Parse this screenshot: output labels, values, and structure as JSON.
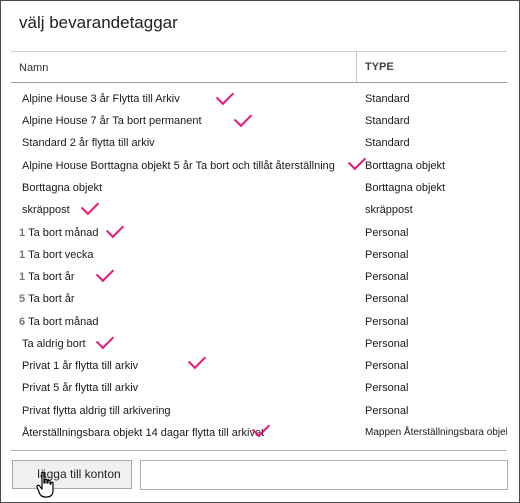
{
  "dialog": {
    "title": "välj bevarandetaggar"
  },
  "table": {
    "headers": {
      "name": "Namn",
      "type": "TYPE"
    },
    "rows": [
      {
        "prefix": "",
        "name": "Alpine House 3 år Flytta till Arkiv",
        "type": "Standard",
        "checked": true
      },
      {
        "prefix": "",
        "name": "Alpine House 7 år Ta bort permanent",
        "type": "Standard",
        "checked": true
      },
      {
        "prefix": "",
        "name": "Standard 2 år flytta till arkiv",
        "type": "Standard",
        "checked": false
      },
      {
        "prefix": "",
        "name": "Alpine House Borttagna objekt 5 år Ta bort och tillåt återställning",
        "type": "Borttagna objekt",
        "checked": true
      },
      {
        "prefix": "",
        "name": "Borttagna objekt",
        "type": "Borttagna objekt",
        "checked": false
      },
      {
        "prefix": "",
        "name": "skräppost",
        "type": "skräppost",
        "checked": true
      },
      {
        "prefix": "1",
        "name": "Ta bort månad",
        "type": "Personal",
        "checked": true
      },
      {
        "prefix": "1",
        "name": "Ta bort vecka",
        "type": "Personal",
        "checked": false
      },
      {
        "prefix": "1",
        "name": "Ta bort år",
        "type": "Personal",
        "checked": true
      },
      {
        "prefix": "5",
        "name": "Ta bort år",
        "type": "Personal",
        "checked": false
      },
      {
        "prefix": "6",
        "name": "Ta bort månad",
        "type": "Personal",
        "checked": false
      },
      {
        "prefix": "",
        "name": "Ta aldrig bort",
        "type": "Personal",
        "checked": true
      },
      {
        "prefix": "",
        "name": "Privat 1 år flytta till arkiv",
        "type": "Personal",
        "checked": true
      },
      {
        "prefix": "",
        "name": "Privat 5 år flytta till arkiv",
        "type": "Personal",
        "checked": false
      },
      {
        "prefix": "",
        "name": "Privat flytta aldrig till arkivering",
        "type": "Personal",
        "checked": false
      },
      {
        "prefix": "",
        "name": "Återställningsbara objekt 14 dagar flytta till arkivet",
        "type": "Mappen Återställningsbara objekt",
        "checked": true
      }
    ]
  },
  "footer": {
    "add_button_label": "lägga till konton",
    "account_input_value": ""
  },
  "colors": {
    "checkmark": "#e8197a",
    "border": "#4a4a4a"
  }
}
